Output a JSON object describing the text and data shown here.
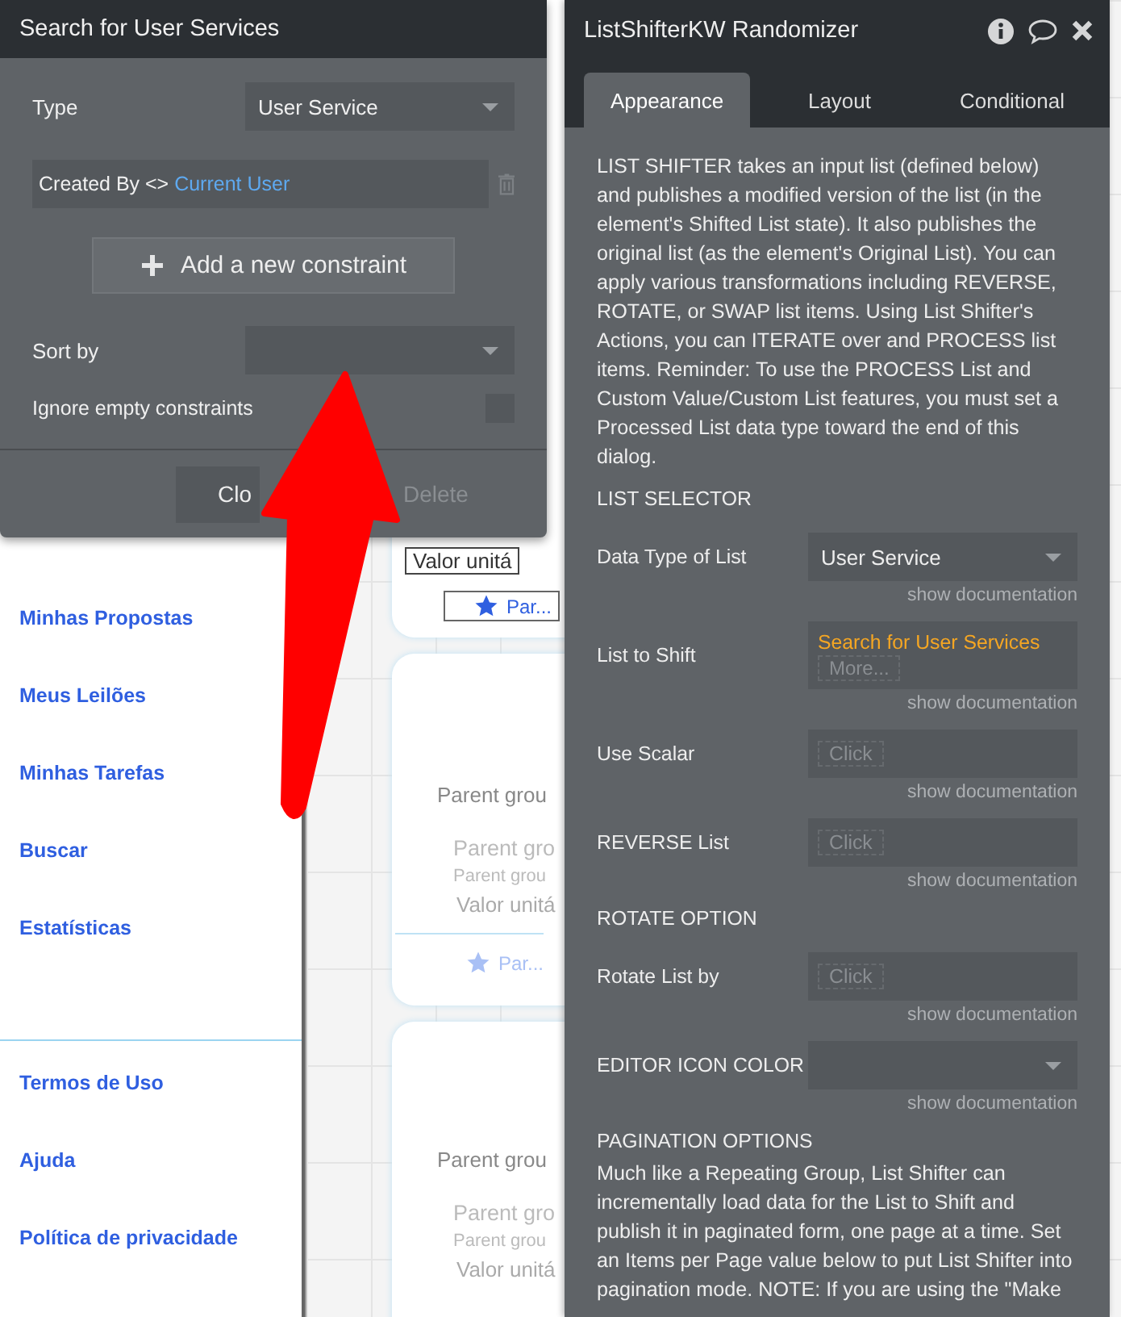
{
  "sidebar": {
    "links": [
      "Minhas Propostas",
      "Meus Leilões",
      "Minhas Tarefas",
      "Buscar",
      "Estatísticas"
    ],
    "footer_links": [
      "Termos de Uso",
      "Ajuda",
      "Política de privacidade"
    ]
  },
  "canvas": {
    "cards": [
      {
        "lines": [
          "Valor unitá"
        ],
        "footer": "Par..."
      },
      {
        "title": "Parent grou",
        "lines": [
          "Parent gro",
          "Parent grou",
          "Valor unitá"
        ],
        "footer": "Par..."
      },
      {
        "title": "Parent grou",
        "lines": [
          "Parent gro",
          "Parent grou",
          "Valor unitá"
        ]
      }
    ]
  },
  "search_dialog": {
    "title": "Search for User Services",
    "type": {
      "label": "Type",
      "value": "User Service"
    },
    "constraint": {
      "field": "Created By <>",
      "value": "Current User"
    },
    "add_button": "Add a new constraint",
    "sort_by": {
      "label": "Sort by"
    },
    "ignore_empty": {
      "label": "Ignore empty constraints",
      "checked": false
    },
    "buttons": [
      {
        "label": "Clo",
        "disabled": false
      },
      {
        "label": "Delete",
        "disabled": true
      }
    ]
  },
  "property_editor": {
    "title": "ListShifterKW Randomizer",
    "tabs": [
      {
        "label": "Appearance",
        "selected": true
      },
      {
        "label": "Layout",
        "selected": false
      },
      {
        "label": "Conditional",
        "selected": false
      }
    ],
    "items": [
      {
        "kind": "paragraph",
        "text": "LIST SHIFTER takes an input list (defined below) and publishes a modified version of the list (in the element's Shifted List state). It also publishes the original list (as the element's Original List). You can apply various transformations including REVERSE, ROTATE, or SWAP list items. Using List Shifter's Actions, you can ITERATE over and PROCESS list items. Reminder: To use the PROCESS List and Custom Value/Custom List features, you must set a Processed List data type toward the end of this dialog."
      },
      {
        "kind": "heading",
        "text": "LIST SELECTOR"
      },
      {
        "kind": "dropdown",
        "label": "Data Type of List",
        "value": "User Service",
        "doc": "show documentation"
      },
      {
        "kind": "expression",
        "label": "List to Shift",
        "value": "Search for User Services",
        "more": "More...",
        "doc": "show documentation"
      },
      {
        "kind": "click",
        "label": "Use Scalar",
        "value": "Click",
        "doc": "show documentation"
      },
      {
        "kind": "click",
        "label": "REVERSE List",
        "value": "Click",
        "doc": "show documentation"
      },
      {
        "kind": "heading",
        "text": "ROTATE OPTION"
      },
      {
        "kind": "click",
        "label": "Rotate List by",
        "value": "Click",
        "doc": "show documentation"
      },
      {
        "kind": "dropdown",
        "label": "EDITOR ICON COLOR",
        "doc": "show documentation"
      },
      {
        "kind": "heading",
        "text": "PAGINATION OPTIONS"
      },
      {
        "kind": "paragraph",
        "text": "Much like a Repeating Group, List Shifter can incrementally load data for the List to Shift and publish it in paginated form, one page at a time. Set an Items per Page value below to put List Shifter into pagination mode. NOTE: If you are using the \"Make"
      }
    ]
  }
}
